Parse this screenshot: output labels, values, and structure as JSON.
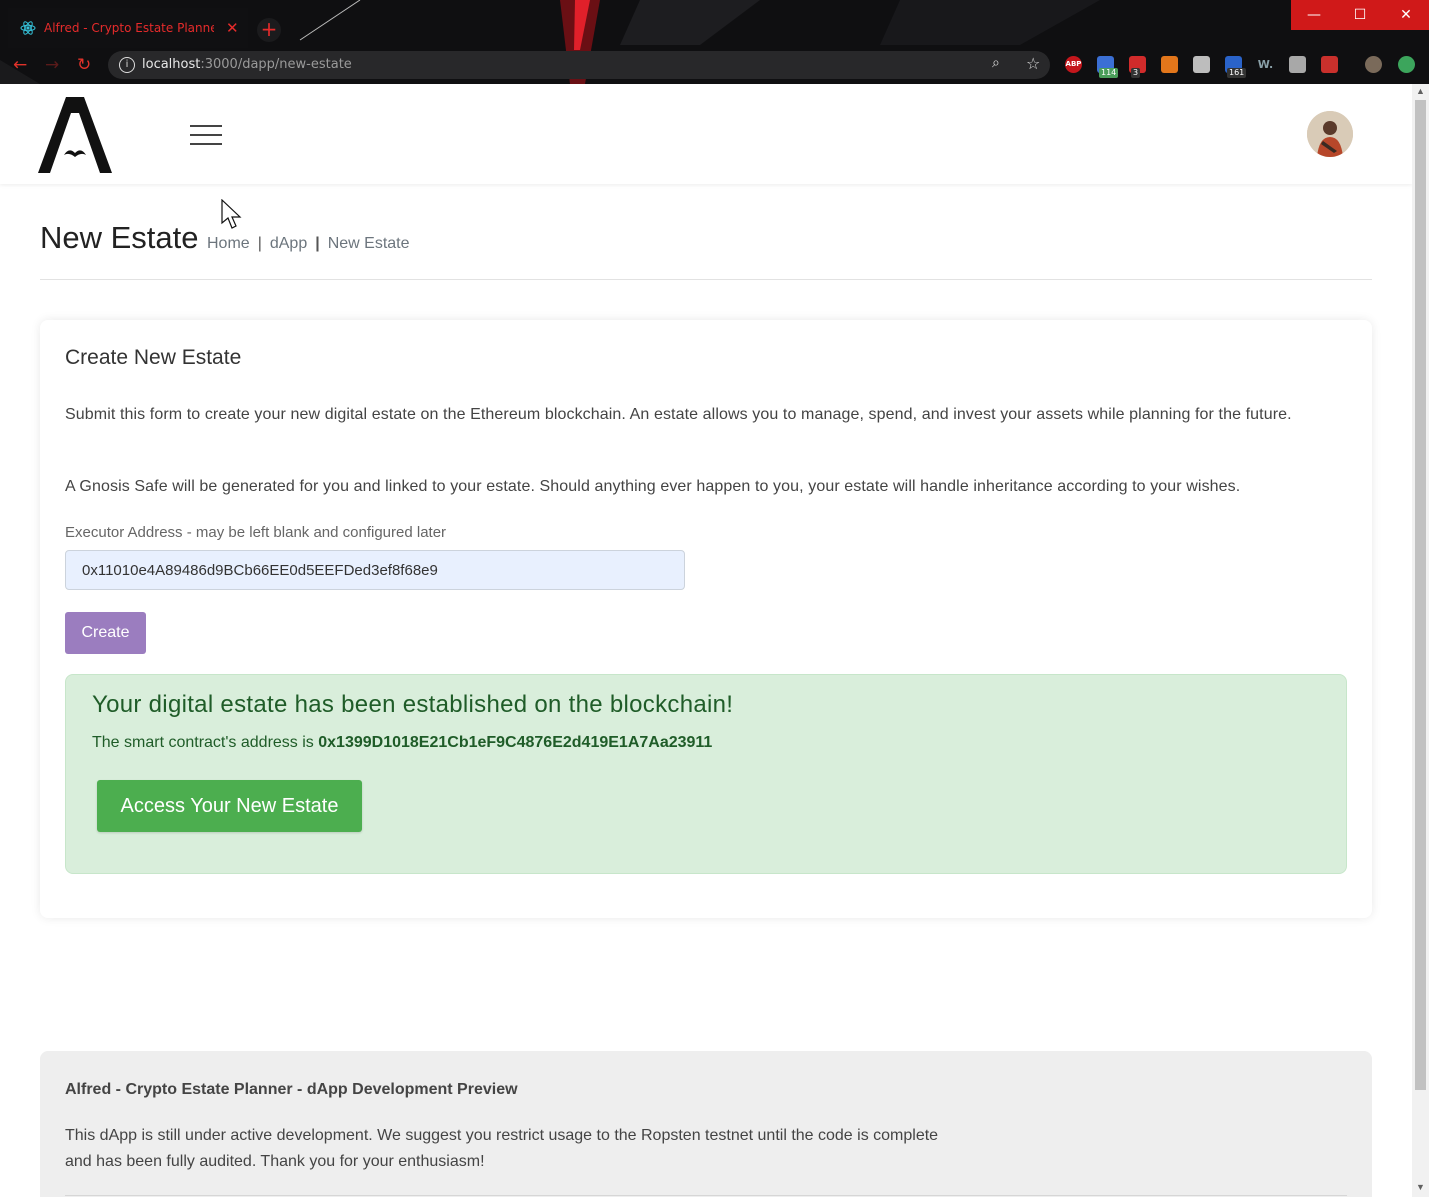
{
  "browser": {
    "tab_title": "Alfred - Crypto Estate Planner - d",
    "tab_close": "✕",
    "new_tab": "+",
    "url_host": "localhost",
    "url_path": ":3000/dapp/new-estate",
    "info_glyph": "i",
    "window_controls": {
      "minimize": "—",
      "maximize": "☐",
      "close": "✕"
    },
    "nav": {
      "back": "←",
      "forward": "→",
      "reload": "↻"
    },
    "extensions": [
      {
        "name": "adblock-icon",
        "label": "ABP",
        "color": "#c4161c"
      },
      {
        "name": "calendar-extension-icon",
        "badge": "114",
        "color": "#3b6fd4"
      },
      {
        "name": "todo-extension-icon",
        "badge": "3",
        "color": "#d12b2b"
      },
      {
        "name": "metamask-icon",
        "color": "#e2761b"
      },
      {
        "name": "drive-icon",
        "color": "#bdbdbd"
      },
      {
        "name": "inbox-extension-icon",
        "badge": "161",
        "color": "#2a63c9"
      },
      {
        "name": "wikiwand-icon",
        "label": "W.",
        "color": "#8aa0a8"
      },
      {
        "name": "shield-extension-icon",
        "color": "#a8a8a8"
      },
      {
        "name": "red-extension-icon",
        "color": "#c9302c"
      },
      {
        "name": "profile-icon",
        "color": "#7a6a5a"
      },
      {
        "name": "update-icon",
        "color": "#3ca55c"
      }
    ]
  },
  "colors": {
    "accent_purple": "#9b7dbf",
    "success_green": "#4cae4f",
    "alert_bg": "#d9eedb",
    "alert_text": "#1f5c28",
    "browser_accent": "#e62b2b"
  },
  "header": {
    "logo_alt": "A",
    "menu_icon": "hamburger-menu-icon",
    "avatar_icon": "user-avatar"
  },
  "page": {
    "title": "New Estate",
    "breadcrumb": [
      "Home",
      "dApp",
      "New Estate"
    ],
    "breadcrumb_separators": [
      "|",
      "|"
    ]
  },
  "card": {
    "title": "Create New Estate",
    "paragraph1": "Submit this form to create your new digital estate on the Ethereum blockchain. An estate allows you to manage, spend, and invest your assets while planning for the future.",
    "paragraph2": "A Gnosis Safe will be generated for you and linked to your estate. Should anything ever happen to you, your estate will handle inheritance according to your wishes.",
    "executor_label": "Executor Address - may be left blank and configured later",
    "executor_value": "0x11010e4A89486d9BCb66EE0d5EEFDed3ef8f68e9",
    "create_button": "Create"
  },
  "alert": {
    "heading": "Your digital estate has been established on the blockchain!",
    "text_prefix": "The smart contract's address is",
    "contract_address": "0x1399D1018E21Cb1eF9C4876E2d419E1A7Aa23911",
    "access_button": "Access Your New Estate"
  },
  "footer": {
    "title": "Alfred - Crypto Estate Planner - dApp Development Preview",
    "text_line1": "This dApp is still under active development. We suggest you restrict usage to the Ropsten testnet until the code is complete",
    "text_line2": "and has been fully audited. Thank you for your enthusiasm!"
  }
}
